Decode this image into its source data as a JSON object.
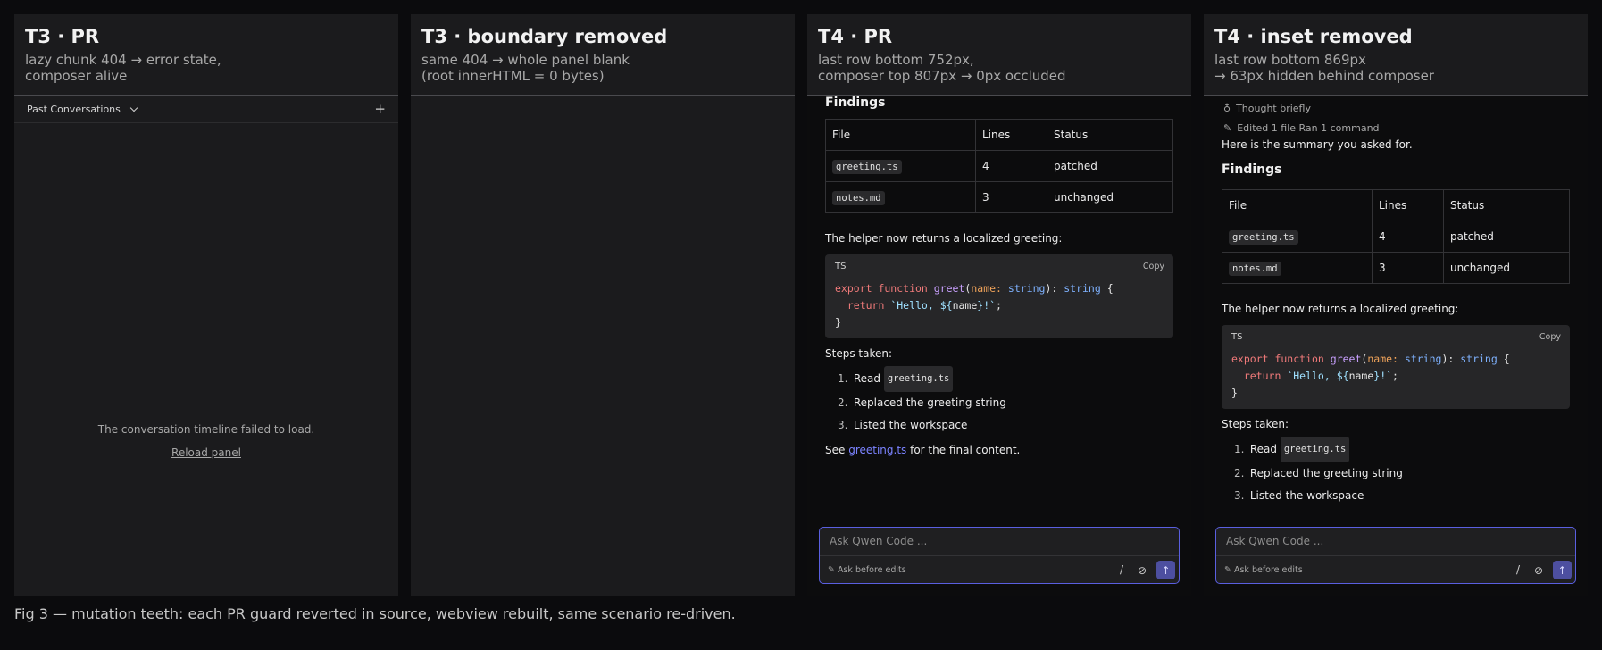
{
  "panels": [
    {
      "title": "T3 · PR",
      "subtitle": [
        "lazy chunk 404 → error state,",
        "composer alive"
      ]
    },
    {
      "title": "T3 · boundary removed",
      "subtitle": [
        "same 404 → whole panel blank",
        "(root innerHTML = 0 bytes)"
      ]
    },
    {
      "title": "T4 · PR",
      "subtitle": [
        "last row bottom 752px,",
        "composer top 807px → 0px occluded"
      ]
    },
    {
      "title": "T4 · inset removed",
      "subtitle": [
        "last row bottom 869px",
        "→ 63px hidden behind composer"
      ]
    }
  ],
  "t3": {
    "toolbar_label": "Past Conversations",
    "error_text": "The conversation timeline failed to load.",
    "reload_label": "Reload panel"
  },
  "chat": {
    "thought": "Thought briefly",
    "edited": "Edited 1 file Ran 1 command",
    "summary": "Here is the summary you asked for.",
    "findings_heading": "Findings",
    "table": {
      "headers": [
        "File",
        "Lines",
        "Status"
      ],
      "rows": [
        [
          "greeting.ts",
          "4",
          "patched"
        ],
        [
          "notes.md",
          "3",
          "unchanged"
        ]
      ]
    },
    "helper_text": "The helper now returns a localized greeting:",
    "code": {
      "lang": "TS",
      "copy_label": "Copy",
      "line1": {
        "kw": "export function ",
        "fn": "greet",
        "p1": "(",
        "prm": "name: ",
        "ty": "string",
        "p2": "): ",
        "ty2": "string",
        "p3": " {"
      },
      "line2": {
        "kw": "  return ",
        "st1": "`Hello, ${",
        "pl": "name",
        "st2": "}!`",
        "p": ";"
      },
      "line3": "}"
    },
    "steps_label": "Steps taken:",
    "steps": [
      {
        "num": "1.",
        "text": "Read ",
        "code": "greeting.ts"
      },
      {
        "num": "2.",
        "text": "Replaced the greeting string"
      },
      {
        "num": "3.",
        "text": "Listed the workspace"
      }
    ],
    "see_prefix": "See ",
    "see_link": "greeting.ts",
    "see_suffix": " for the final content."
  },
  "composer": {
    "placeholder": "Ask Qwen Code ...",
    "mode_label": "Ask before edits",
    "slash": "/"
  },
  "caption": "Fig 3 — mutation teeth: each PR guard reverted in source, webview rebuilt, same scenario re-driven.",
  "colors": {
    "accent": "#5a5fe0",
    "link": "#7b83ff",
    "send": "#4d4fa0"
  }
}
